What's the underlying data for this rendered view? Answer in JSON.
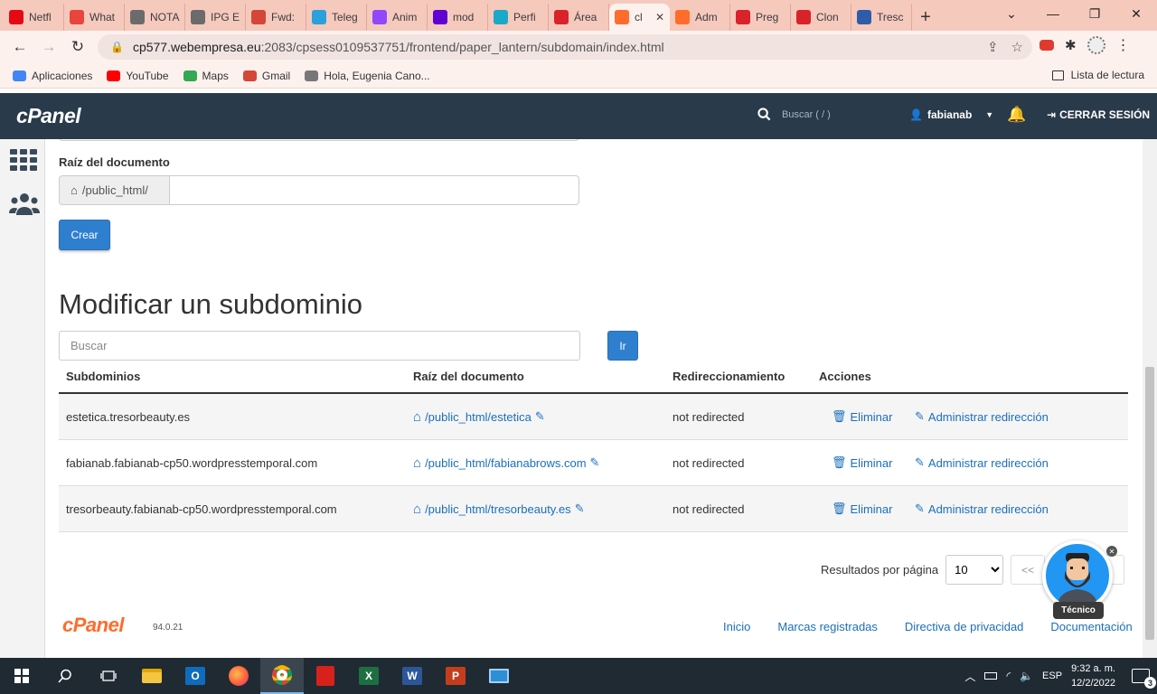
{
  "browser": {
    "tabs": [
      {
        "label": "Netfl",
        "icon": "netflix-icon",
        "color": "#e50914"
      },
      {
        "label": "What",
        "icon": "alert-icon",
        "color": "#e8453c"
      },
      {
        "label": "NOTA",
        "icon": "globe-icon",
        "color": "#6b6b6b"
      },
      {
        "label": "IPG E",
        "icon": "globe-icon",
        "color": "#6b6b6b"
      },
      {
        "label": "Fwd:",
        "icon": "gmail-icon",
        "color": "#d44638"
      },
      {
        "label": "Teleg",
        "icon": "telegram-icon",
        "color": "#2aa1da"
      },
      {
        "label": "Anim",
        "icon": "twitch-icon",
        "color": "#9146ff"
      },
      {
        "label": "mod",
        "icon": "yahoo-icon",
        "color": "#6001d2"
      },
      {
        "label": "Perfi",
        "icon": "perfil-icon",
        "color": "#1aa9c9"
      },
      {
        "label": "Área",
        "icon": "webempresa-icon",
        "color": "#d8232a"
      },
      {
        "label": "cl",
        "icon": "cpanel-icon",
        "color": "#ff6c2c",
        "active": true
      },
      {
        "label": "Adm",
        "icon": "cpanel-icon",
        "color": "#ff6c2c"
      },
      {
        "label": "Preg",
        "icon": "webempresa-icon",
        "color": "#d8232a"
      },
      {
        "label": "Clon",
        "icon": "webempresa-icon",
        "color": "#d8232a"
      },
      {
        "label": "Tresc",
        "icon": "calendar-icon",
        "color": "#2e5ca8"
      }
    ],
    "url_host": "cp577.webempresa.eu",
    "url_path": ":2083/cpsess0109537751/frontend/paper_lantern/subdomain/index.html",
    "bookmarks": [
      {
        "label": "Aplicaciones",
        "icon": "apps-grid-icon"
      },
      {
        "label": "YouTube",
        "icon": "youtube-icon"
      },
      {
        "label": "Maps",
        "icon": "maps-icon"
      },
      {
        "label": "Gmail",
        "icon": "gmail-icon"
      },
      {
        "label": "Hola, Eugenia Cano...",
        "icon": "dots-icon"
      }
    ],
    "reading_list": "Lista de lectura"
  },
  "header": {
    "logo": "cPanel",
    "search_placeholder": "Buscar ( / )",
    "username": "fabianab",
    "logout": "CERRAR SESIÓN"
  },
  "create_form": {
    "doc_root_label": "Raíz del documento",
    "doc_root_prefix": "/public_html/",
    "doc_root_value": "",
    "create_button": "Crear"
  },
  "modify": {
    "title": "Modificar un subdominio",
    "search_placeholder": "Buscar",
    "go_button": "Ir",
    "columns": [
      "Subdominios",
      "Raíz del documento",
      "Redireccionamiento",
      "Acciones"
    ],
    "rows": [
      {
        "subdomain": "estetica.tresorbeauty.es",
        "root": "/public_html/estetica",
        "redirect": "not redirected",
        "delete": "Eliminar",
        "manage": "Administrar redirección"
      },
      {
        "subdomain": "fabianab.fabianab-cp50.wordpresstemporal.com",
        "root": "/public_html/fabianabrows.com",
        "redirect": "not redirected",
        "delete": "Eliminar",
        "manage": "Administrar redirección"
      },
      {
        "subdomain": "tresorbeauty.fabianab-cp50.wordpresstemporal.com",
        "root": "/public_html/tresorbeauty.es",
        "redirect": "not redirected",
        "delete": "Eliminar",
        "manage": "Administrar redirección"
      }
    ],
    "per_page_label": "Resultados por página",
    "per_page_value": "10",
    "first_page": "<<"
  },
  "footer": {
    "logo": "cPanel",
    "version": "94.0.21",
    "links": [
      "Inicio",
      "Marcas registradas",
      "Directiva de privacidad",
      "Documentación"
    ]
  },
  "chat": {
    "label": "Técnico"
  },
  "taskbar": {
    "lang": "ESP",
    "time": "9:32 a. m.",
    "date": "12/2/2022",
    "notifications": "3"
  },
  "colors": {
    "accent": "#2f7fcf",
    "link": "#1b6fba",
    "header": "#293a4a",
    "cpanel_orange": "#ff6c2c"
  }
}
